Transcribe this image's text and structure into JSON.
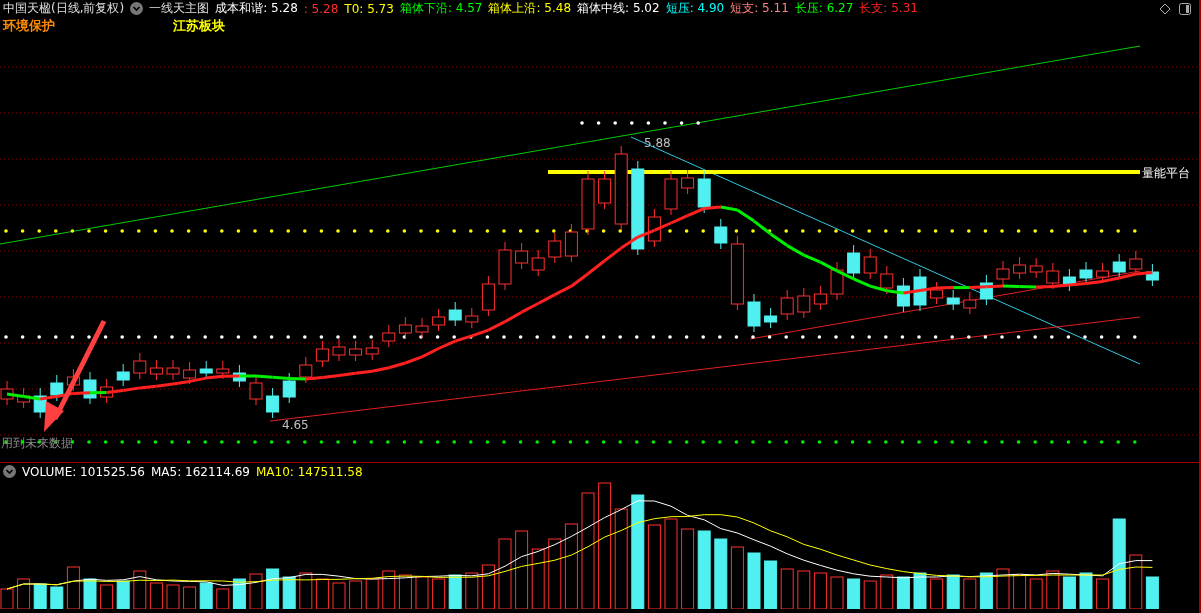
{
  "header": {
    "title": "中国天楹(日线,前复权)",
    "indicator": "一线天主图",
    "values": [
      {
        "label": "成本和谐: 5.28",
        "color": "#ffffff"
      },
      {
        "label": ": 5.28",
        "color": "#ff3030"
      },
      {
        "label": "T0: 5.73",
        "color": "#ffff00"
      },
      {
        "label": "箱体下沿: 4.57",
        "color": "#00ff00"
      },
      {
        "label": "箱体上沿: 5.48",
        "color": "#ffff00"
      },
      {
        "label": "箱体中线: 5.02",
        "color": "#ffffff"
      },
      {
        "label": "短压: 4.90",
        "color": "#00ffff"
      },
      {
        "label": "短支: 5.11",
        "color": "#ff8080"
      },
      {
        "label": "长压: 6.27",
        "color": "#00ff00"
      },
      {
        "label": "长支: 5.31",
        "color": "#ff2020"
      }
    ]
  },
  "sectors": [
    {
      "label": "环境保护",
      "color": "#ff8c00"
    },
    {
      "label": "江苏板块",
      "color": "#ffff00"
    }
  ],
  "chart": {
    "high_label": "5.88",
    "low_label": "4.65",
    "platform_label": "量能平台",
    "warning_label": "用到未来数据"
  },
  "volume": {
    "values": [
      {
        "label": "VOLUME: 101525.56",
        "color": "#ffffff"
      },
      {
        "label": "MA5: 162114.69",
        "color": "#ffffff"
      },
      {
        "label": "MA10: 147511.58",
        "color": "#ffff00"
      }
    ]
  }
}
